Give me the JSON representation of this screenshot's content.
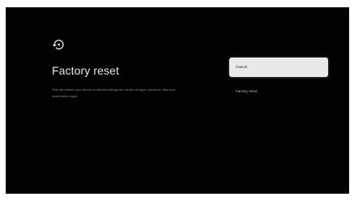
{
  "screen": {
    "title": "Factory reset",
    "description": "This will restore your device to default settings and delete all apps, accounts, files and downloaded apps.",
    "icon": "reset-history-icon"
  },
  "options": [
    {
      "label": "Cancel",
      "state": "focused"
    },
    {
      "label": "Factory reset",
      "state": "unfocused"
    }
  ],
  "colors": {
    "background": "#020202",
    "title": "#e6e6e6",
    "description": "#8a8a8a",
    "focused_option_bg": "#e9e9e9",
    "focused_option_text": "#262626",
    "unfocused_option_text": "#bdbdbd"
  }
}
